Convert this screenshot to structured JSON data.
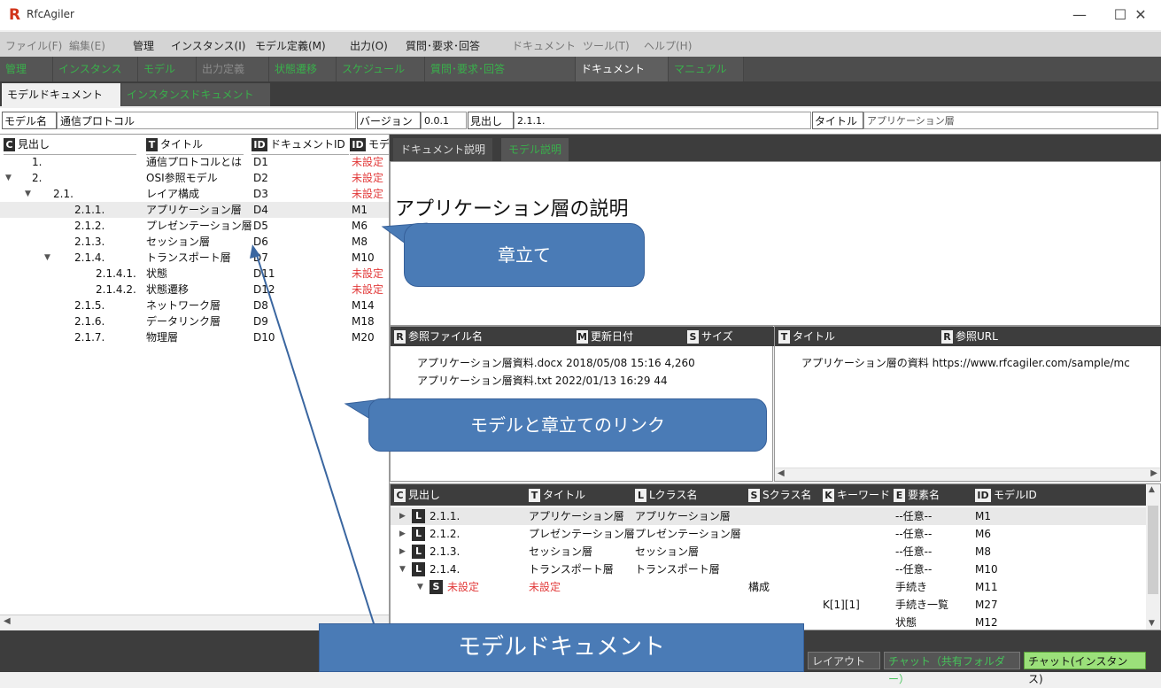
{
  "window": {
    "title": "RfcAgiler",
    "logo": "R",
    "minimize": "—",
    "maximize": "☐",
    "close": "✕"
  },
  "menu": [
    "ファイル(F)",
    "編集(E)",
    "管理",
    "インスタンス(I)",
    "モデル定義(M)",
    "出力(O)",
    "質問･要求･回答",
    "ドキュメント",
    "ツール(T)",
    "ヘルプ(H)"
  ],
  "tabs1": [
    "管理",
    "インスタンス",
    "モデル",
    "出力定義",
    "状態遷移",
    "スケジュール",
    "質問･要求･回答",
    "ドキュメント",
    "マニュアル"
  ],
  "tabs2": [
    "モデルドキュメント",
    "インスタンスドキュメント"
  ],
  "fields": {
    "model_label": "モデル名",
    "model_value": "通信プロトコル",
    "version_label": "バージョン",
    "version_value": "0.0.1",
    "heading_label": "見出し",
    "heading_value": "2.1.1.",
    "title_label": "タイトル",
    "title_value": "アプリケーション層"
  },
  "tree": {
    "headers": [
      {
        "badge": "C",
        "label": "見出し"
      },
      {
        "badge": "T",
        "label": "タイトル"
      },
      {
        "badge": "ID",
        "label": "ドキュメントID"
      },
      {
        "badge": "ID",
        "label": "モデ"
      }
    ],
    "rows": [
      {
        "toggle": "",
        "heading": "1.",
        "title": "通信プロトコルとは",
        "doc_id": "D1",
        "model": "未設定"
      },
      {
        "toggle": "▼",
        "heading": "2.",
        "title": "OSI参照モデル",
        "doc_id": "D2",
        "model": "未設定"
      },
      {
        "toggle": "▼",
        "heading": "2.1.",
        "title": "レイア構成",
        "doc_id": "D3",
        "model": "未設定"
      },
      {
        "toggle": "",
        "heading": "2.1.1.",
        "title": "アプリケーション層",
        "doc_id": "D4",
        "model": "M1"
      },
      {
        "toggle": "",
        "heading": "2.1.2.",
        "title": "プレゼンテーション層",
        "doc_id": "D5",
        "model": "M6"
      },
      {
        "toggle": "",
        "heading": "2.1.3.",
        "title": "セッション層",
        "doc_id": "D6",
        "model": "M8"
      },
      {
        "toggle": "▼",
        "heading": "2.1.4.",
        "title": "トランスポート層",
        "doc_id": "D7",
        "model": "M10"
      },
      {
        "toggle": "",
        "heading": "2.1.4.1.",
        "title": "状態",
        "doc_id": "D11",
        "model": "未設定"
      },
      {
        "toggle": "",
        "heading": "2.1.4.2.",
        "title": "状態遷移",
        "doc_id": "D12",
        "model": "未設定"
      },
      {
        "toggle": "",
        "heading": "2.1.5.",
        "title": "ネットワーク層",
        "doc_id": "D8",
        "model": "M14"
      },
      {
        "toggle": "",
        "heading": "2.1.6.",
        "title": "データリンク層",
        "doc_id": "D9",
        "model": "M18"
      },
      {
        "toggle": "",
        "heading": "2.1.7.",
        "title": "物理層",
        "doc_id": "D10",
        "model": "M20"
      }
    ]
  },
  "doc_tabs": [
    "ドキュメント説明",
    "モデル説明"
  ],
  "doc_heading": "アプリケーション層の説明",
  "ref_files": {
    "headers": [
      {
        "badge": "R",
        "label": "参照ファイル名"
      },
      {
        "badge": "M",
        "label": "更新日付"
      },
      {
        "badge": "S",
        "label": "サイズ"
      }
    ],
    "rows": [
      {
        "name": "アプリケーション層資料.docx",
        "date": "2018/05/08 15:16",
        "size": "4,260"
      },
      {
        "name": "アプリケーション層資料.txt",
        "date": "2022/01/13 16:29",
        "size": "44"
      }
    ]
  },
  "ref_urls": {
    "headers": [
      {
        "badge": "T",
        "label": "タイトル"
      },
      {
        "badge": "R",
        "label": "参照URL"
      }
    ],
    "rows": [
      {
        "title": "アプリケーション層の資料",
        "url": "https://www.rfcagiler.com/sample/mc"
      }
    ]
  },
  "model_table": {
    "headers": [
      {
        "badge": "C",
        "label": "見出し"
      },
      {
        "badge": "T",
        "label": "タイトル"
      },
      {
        "badge": "L",
        "label": "Lクラス名"
      },
      {
        "badge": "S",
        "label": "Sクラス名"
      },
      {
        "badge": "K",
        "label": "キーワード"
      },
      {
        "badge": "E",
        "label": "要素名"
      },
      {
        "badge": "ID",
        "label": "モデルID"
      }
    ],
    "rows": [
      {
        "toggle": "▶",
        "type": "L",
        "heading": "2.1.1.",
        "title": "アプリケーション層",
        "lclass": "アプリケーション層",
        "sclass": "",
        "keyword": "",
        "element": "--任意--",
        "model_id": "M1"
      },
      {
        "toggle": "▶",
        "type": "L",
        "heading": "2.1.2.",
        "title": "プレゼンテーション層",
        "lclass": "プレゼンテーション層",
        "sclass": "",
        "keyword": "",
        "element": "--任意--",
        "model_id": "M6"
      },
      {
        "toggle": "▶",
        "type": "L",
        "heading": "2.1.3.",
        "title": "セッション層",
        "lclass": "セッション層",
        "sclass": "",
        "keyword": "",
        "element": "--任意--",
        "model_id": "M8"
      },
      {
        "toggle": "▼",
        "type": "L",
        "heading": "2.1.4.",
        "title": "トランスポート層",
        "lclass": "トランスポート層",
        "sclass": "",
        "keyword": "",
        "element": "--任意--",
        "model_id": "M10"
      },
      {
        "toggle": "▼",
        "type": "S",
        "heading": "未設定",
        "title": "未設定",
        "lclass": "",
        "sclass": "構成",
        "keyword": "",
        "element": "手続き",
        "model_id": "M11"
      },
      {
        "toggle": "",
        "type": "",
        "heading": "",
        "title": "",
        "lclass": "",
        "sclass": "",
        "keyword": "K[1][1]",
        "element": "手続き一覧",
        "model_id": "M27"
      },
      {
        "toggle": "",
        "type": "",
        "heading": "",
        "title": "",
        "lclass": "",
        "sclass": "",
        "keyword": "",
        "element": "状態",
        "model_id": "M12"
      }
    ]
  },
  "status_buttons": {
    "layout": "レイアウト",
    "chat_shared": "チャット（共有フォルダー）",
    "chat_instance": "チャット(インスタンス)"
  },
  "callouts": {
    "chapter": "章立て",
    "link": "モデルと章立てのリンク",
    "title": "モデルドキュメント"
  },
  "colors": {
    "green_tab": "#39b04b",
    "red_text": "#e23b3b",
    "callout": "#4a7bb6",
    "dark_bar": "#3d3d3d"
  }
}
